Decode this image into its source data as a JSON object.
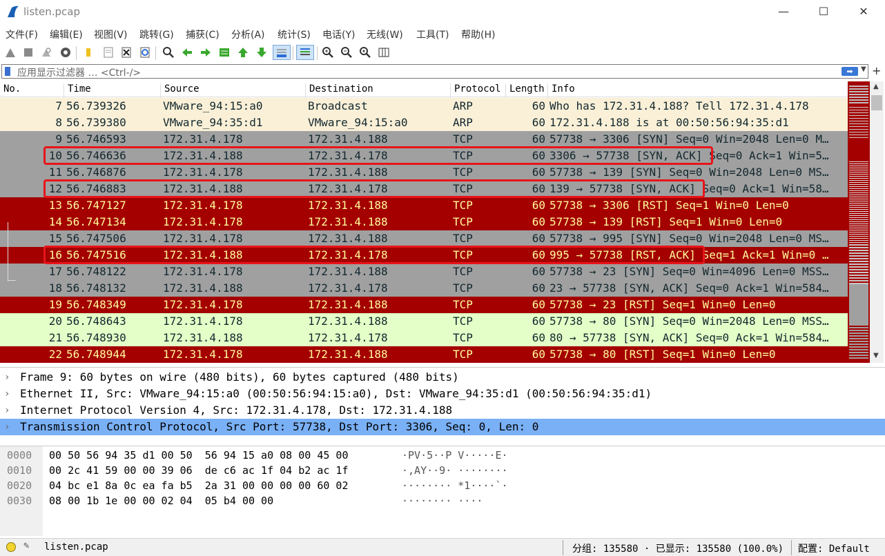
{
  "window": {
    "title": "listen.pcap",
    "minimize": "—",
    "maximize": "☐",
    "close": "✕"
  },
  "menu": [
    "文件(F)",
    "编辑(E)",
    "视图(V)",
    "跳转(G)",
    "捕获(C)",
    "分析(A)",
    "统计(S)",
    "电话(Y)",
    "无线(W)",
    "工具(T)",
    "帮助(H)"
  ],
  "filter": {
    "placeholder": "应用显示过滤器 … <Ctrl-/>"
  },
  "columns": [
    "No.",
    "Time",
    "Source",
    "Destination",
    "Protocol",
    "Length",
    "Info"
  ],
  "packets": [
    {
      "no": "7",
      "time": "56.739326",
      "src": "VMware_94:15:a0",
      "dst": "Broadcast",
      "proto": "ARP",
      "len": "60",
      "info": "Who has 172.31.4.188? Tell 172.31.4.178",
      "style": "arp"
    },
    {
      "no": "8",
      "time": "56.739380",
      "src": "VMware_94:35:d1",
      "dst": "VMware_94:15:a0",
      "proto": "ARP",
      "len": "60",
      "info": "172.31.4.188 is at 00:50:56:94:35:d1",
      "style": "arp"
    },
    {
      "no": "9",
      "time": "56.746593",
      "src": "172.31.4.178",
      "dst": "172.31.4.188",
      "proto": "TCP",
      "len": "60",
      "info": "57738 → 3306 [SYN] Seq=0 Win=2048 Len=0 M…",
      "style": "gray"
    },
    {
      "no": "10",
      "time": "56.746636",
      "src": "172.31.4.188",
      "dst": "172.31.4.178",
      "proto": "TCP",
      "len": "60",
      "info": "3306 → 57738 [SYN, ACK] Seq=0 Ack=1 Win=5…",
      "style": "gray"
    },
    {
      "no": "11",
      "time": "56.746876",
      "src": "172.31.4.178",
      "dst": "172.31.4.188",
      "proto": "TCP",
      "len": "60",
      "info": "57738 → 139 [SYN] Seq=0 Win=2048 Len=0 MS…",
      "style": "gray"
    },
    {
      "no": "12",
      "time": "56.746883",
      "src": "172.31.4.188",
      "dst": "172.31.4.178",
      "proto": "TCP",
      "len": "60",
      "info": "139 → 57738 [SYN, ACK] Seq=0 Ack=1 Win=58…",
      "style": "gray"
    },
    {
      "no": "13",
      "time": "56.747127",
      "src": "172.31.4.178",
      "dst": "172.31.4.188",
      "proto": "TCP",
      "len": "60",
      "info": "57738 → 3306 [RST] Seq=1 Win=0 Len=0",
      "style": "red"
    },
    {
      "no": "14",
      "time": "56.747134",
      "src": "172.31.4.178",
      "dst": "172.31.4.188",
      "proto": "TCP",
      "len": "60",
      "info": "57738 → 139 [RST] Seq=1 Win=0 Len=0",
      "style": "red"
    },
    {
      "no": "15",
      "time": "56.747506",
      "src": "172.31.4.178",
      "dst": "172.31.4.188",
      "proto": "TCP",
      "len": "60",
      "info": "57738 → 995 [SYN] Seq=0 Win=2048 Len=0 MS…",
      "style": "gray"
    },
    {
      "no": "16",
      "time": "56.747516",
      "src": "172.31.4.188",
      "dst": "172.31.4.178",
      "proto": "TCP",
      "len": "60",
      "info": "995 → 57738 [RST, ACK] Seq=1 Ack=1 Win=0 …",
      "style": "red"
    },
    {
      "no": "17",
      "time": "56.748122",
      "src": "172.31.4.178",
      "dst": "172.31.4.188",
      "proto": "TCP",
      "len": "60",
      "info": "57738 → 23 [SYN] Seq=0 Win=4096 Len=0 MSS…",
      "style": "gray"
    },
    {
      "no": "18",
      "time": "56.748132",
      "src": "172.31.4.188",
      "dst": "172.31.4.178",
      "proto": "TCP",
      "len": "60",
      "info": "23 → 57738 [SYN, ACK] Seq=0 Ack=1 Win=584…",
      "style": "gray"
    },
    {
      "no": "19",
      "time": "56.748349",
      "src": "172.31.4.178",
      "dst": "172.31.4.188",
      "proto": "TCP",
      "len": "60",
      "info": "57738 → 23 [RST] Seq=1 Win=0 Len=0",
      "style": "red"
    },
    {
      "no": "20",
      "time": "56.748643",
      "src": "172.31.4.178",
      "dst": "172.31.4.188",
      "proto": "TCP",
      "len": "60",
      "info": "57738 → 80 [SYN] Seq=0 Win=2048 Len=0 MSS…",
      "style": "green"
    },
    {
      "no": "21",
      "time": "56.748930",
      "src": "172.31.4.188",
      "dst": "172.31.4.178",
      "proto": "TCP",
      "len": "60",
      "info": "80 → 57738 [SYN, ACK] Seq=0 Ack=1 Win=584…",
      "style": "green"
    },
    {
      "no": "22",
      "time": "56.748944",
      "src": "172.31.4.178",
      "dst": "172.31.4.188",
      "proto": "TCP",
      "len": "60",
      "info": "57738 → 80 [RST] Seq=1 Win=0 Len=0",
      "style": "red"
    }
  ],
  "details": [
    "Frame 9: 60 bytes on wire (480 bits), 60 bytes captured (480 bits)",
    "Ethernet II, Src: VMware_94:15:a0 (00:50:56:94:15:a0), Dst: VMware_94:35:d1 (00:50:56:94:35:d1)",
    "Internet Protocol Version 4, Src: 172.31.4.178, Dst: 172.31.4.188",
    "Transmission Control Protocol, Src Port: 57738, Dst Port: 3306, Seq: 0, Len: 0"
  ],
  "bytes": [
    {
      "off": "0000",
      "hex": "00 50 56 94 35 d1 00 50  56 94 15 a0 08 00 45 00",
      "ascii": "·PV·5··P V·····E·"
    },
    {
      "off": "0010",
      "hex": "00 2c 41 59 00 00 39 06  de c6 ac 1f 04 b2 ac 1f",
      "ascii": "·,AY··9· ········"
    },
    {
      "off": "0020",
      "hex": "04 bc e1 8a 0c ea fa b5  2a 31 00 00 00 00 60 02",
      "ascii": "········ *1····`·"
    },
    {
      "off": "0030",
      "hex": "08 00 1b 1e 00 00 02 04  05 b4 00 00",
      "ascii": "········ ····"
    }
  ],
  "status": {
    "file": "listen.pcap",
    "packets": "分组: 135580 · 已显示: 135580 (100.0%)",
    "profile": "配置: Default"
  },
  "colors": {
    "arp": "#faf0d7",
    "tcp_gray": "#a0a0a0",
    "tcp_red": "#a40000",
    "http_green": "#e4ffc7",
    "selected_detail": "#7ab0f5",
    "highlight_box": "#e8141a"
  }
}
